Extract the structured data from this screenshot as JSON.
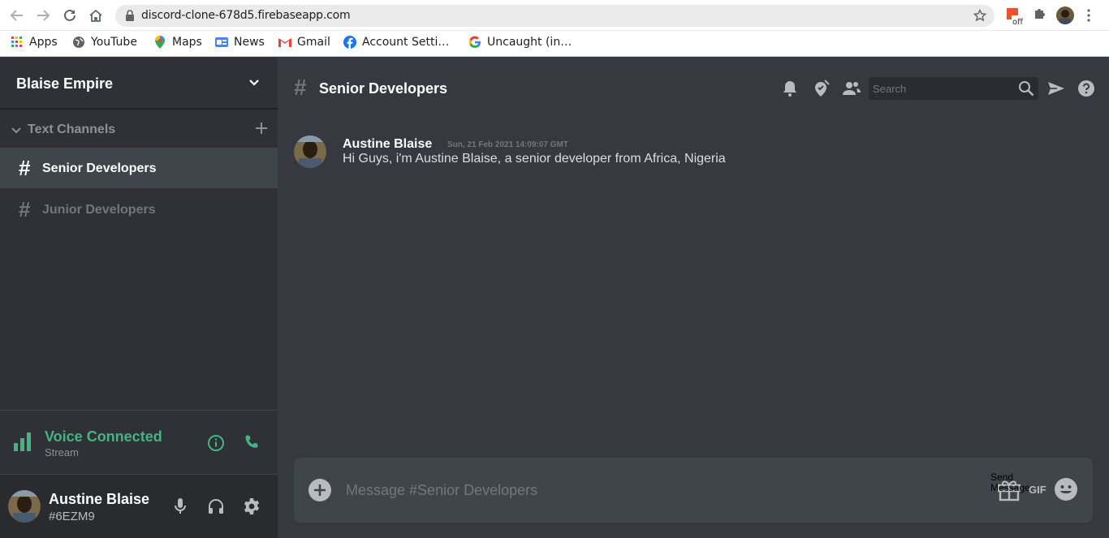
{
  "browser": {
    "url": "discord-clone-678d5.firebaseapp.com",
    "bookmarks": [
      {
        "label": "Apps",
        "icon": "apps-grid-icon"
      },
      {
        "label": "YouTube",
        "icon": "globe-icon"
      },
      {
        "label": "Maps",
        "icon": "maps-pin-icon"
      },
      {
        "label": "News",
        "icon": "news-icon"
      },
      {
        "label": "Gmail",
        "icon": "gmail-icon"
      },
      {
        "label": "Account Setti…",
        "icon": "facebook-icon"
      },
      {
        "label": "Uncaught (in…",
        "icon": "google-icon"
      }
    ],
    "extension_badge": "off"
  },
  "sidebar": {
    "server_name": "Blaise Empire",
    "section_label": "Text Channels",
    "channels": [
      {
        "name": "Senior Developers",
        "active": true
      },
      {
        "name": "Junior Developers",
        "active": false
      }
    ],
    "voice": {
      "status": "Voice Connected",
      "sub": "Stream"
    },
    "user": {
      "name": "Austine Blaise",
      "tag": "#6EZM9"
    }
  },
  "main": {
    "channel_name": "Senior Developers",
    "search_placeholder": "Search",
    "messages": [
      {
        "author": "Austine Blaise",
        "timestamp": "Sun, 21 Feb 2021 14:09:07 GMT",
        "text": "Hi Guys, i'm Austine Blaise, a senior developer from Africa, Nigeria"
      }
    ],
    "composer": {
      "placeholder": "Message #Senior Developers",
      "send_label": "Send Message",
      "gif_label": "GIF"
    }
  },
  "colors": {
    "sidebar_bg": "#2f3136",
    "main_bg": "#36393f",
    "active_channel_bg": "#40444b",
    "voice_green": "#43b581",
    "muted_text": "#72767d"
  }
}
